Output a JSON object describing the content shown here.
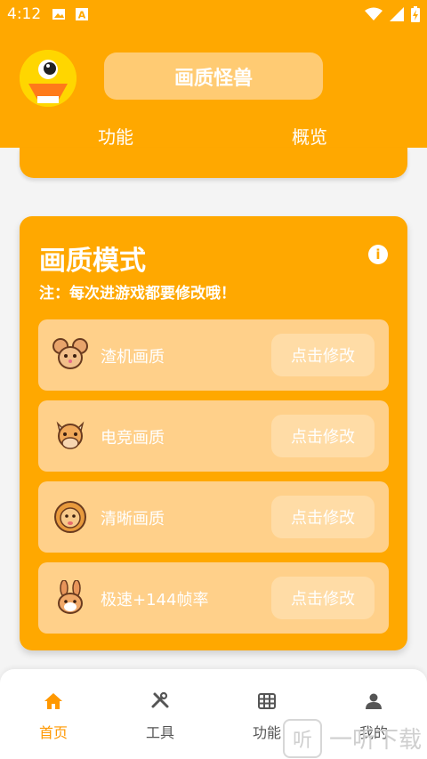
{
  "status_bar": {
    "time": "4:12"
  },
  "header": {
    "app_title": "画质怪兽",
    "tabs": [
      "功能",
      "概览"
    ]
  },
  "mode_card": {
    "title": "画质模式",
    "note": "注：每次进游戏都要修改哦！",
    "modes": [
      {
        "label": "渣机画质",
        "icon": "mouse-face-icon",
        "button": "点击修改"
      },
      {
        "label": "电竞画质",
        "icon": "cow-face-icon",
        "button": "点击修改"
      },
      {
        "label": "清晰画质",
        "icon": "lion-face-icon",
        "button": "点击修改"
      },
      {
        "label": "极速+144帧率",
        "icon": "rabbit-face-icon",
        "button": "点击修改"
      }
    ]
  },
  "bottom_nav": [
    {
      "label": "首页",
      "icon": "home-icon",
      "active": true
    },
    {
      "label": "工具",
      "icon": "tools-icon",
      "active": false
    },
    {
      "label": "功能",
      "icon": "grid-icon",
      "active": false
    },
    {
      "label": "我的",
      "icon": "user-icon",
      "active": false
    }
  ],
  "watermark": {
    "text": "一听下载"
  },
  "colors": {
    "primary": "#ffa800",
    "row_bg": "#ffd08a",
    "button_bg": "#ffdca6"
  }
}
